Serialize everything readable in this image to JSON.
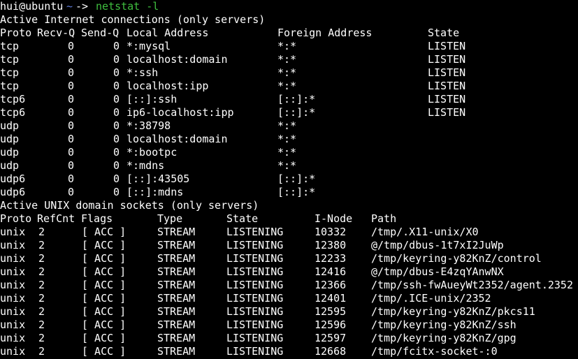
{
  "colors": {
    "background": "#000000",
    "foreground": "#ffffff",
    "tilde": "#5f7ddd",
    "command": "#3fbf3f"
  },
  "prompt": {
    "user_host": "hui@ubuntu",
    "cwd": "~",
    "arrow": "->",
    "command": "netstat -l"
  },
  "internet": {
    "title": "Active Internet connections (only servers)",
    "headers": [
      "Proto",
      "Recv-Q",
      "Send-Q",
      "Local Address",
      "Foreign Address",
      "State"
    ],
    "rows": [
      [
        "tcp",
        "0",
        "0",
        "*:mysql",
        "*:*",
        "LISTEN"
      ],
      [
        "tcp",
        "0",
        "0",
        "localhost:domain",
        "*:*",
        "LISTEN"
      ],
      [
        "tcp",
        "0",
        "0",
        "*:ssh",
        "*:*",
        "LISTEN"
      ],
      [
        "tcp",
        "0",
        "0",
        "localhost:ipp",
        "*:*",
        "LISTEN"
      ],
      [
        "tcp6",
        "0",
        "0",
        "[::]:ssh",
        "[::]:*",
        "LISTEN"
      ],
      [
        "tcp6",
        "0",
        "0",
        "ip6-localhost:ipp",
        "[::]:*",
        "LISTEN"
      ],
      [
        "udp",
        "0",
        "0",
        "*:38798",
        "*:*",
        ""
      ],
      [
        "udp",
        "0",
        "0",
        "localhost:domain",
        "*:*",
        ""
      ],
      [
        "udp",
        "0",
        "0",
        "*:bootpc",
        "*:*",
        ""
      ],
      [
        "udp",
        "0",
        "0",
        "*:mdns",
        "*:*",
        ""
      ],
      [
        "udp6",
        "0",
        "0",
        "[::]:43505",
        "[::]:*",
        ""
      ],
      [
        "udp6",
        "0",
        "0",
        "[::]:mdns",
        "[::]:*",
        ""
      ]
    ]
  },
  "unix": {
    "title": "Active UNIX domain sockets (only servers)",
    "headers": [
      "Proto",
      "RefCnt",
      "Flags",
      "Type",
      "State",
      "I-Node",
      "Path"
    ],
    "rows": [
      [
        "unix",
        "2",
        "[ ACC ]",
        "STREAM",
        "LISTENING",
        "10332",
        "/tmp/.X11-unix/X0"
      ],
      [
        "unix",
        "2",
        "[ ACC ]",
        "STREAM",
        "LISTENING",
        "12380",
        "@/tmp/dbus-1t7xI2JuWp"
      ],
      [
        "unix",
        "2",
        "[ ACC ]",
        "STREAM",
        "LISTENING",
        "12233",
        "/tmp/keyring-y82KnZ/control"
      ],
      [
        "unix",
        "2",
        "[ ACC ]",
        "STREAM",
        "LISTENING",
        "12416",
        "@/tmp/dbus-E4zqYAnwNX"
      ],
      [
        "unix",
        "2",
        "[ ACC ]",
        "STREAM",
        "LISTENING",
        "12366",
        "/tmp/ssh-fwAueyWt2352/agent.2352"
      ],
      [
        "unix",
        "2",
        "[ ACC ]",
        "STREAM",
        "LISTENING",
        "12401",
        "/tmp/.ICE-unix/2352"
      ],
      [
        "unix",
        "2",
        "[ ACC ]",
        "STREAM",
        "LISTENING",
        "12595",
        "/tmp/keyring-y82KnZ/pkcs11"
      ],
      [
        "unix",
        "2",
        "[ ACC ]",
        "STREAM",
        "LISTENING",
        "12596",
        "/tmp/keyring-y82KnZ/ssh"
      ],
      [
        "unix",
        "2",
        "[ ACC ]",
        "STREAM",
        "LISTENING",
        "12597",
        "/tmp/keyring-y82KnZ/gpg"
      ],
      [
        "unix",
        "2",
        "[ ACC ]",
        "STREAM",
        "LISTENING",
        "12668",
        "/tmp/fcitx-socket-:0"
      ]
    ]
  }
}
